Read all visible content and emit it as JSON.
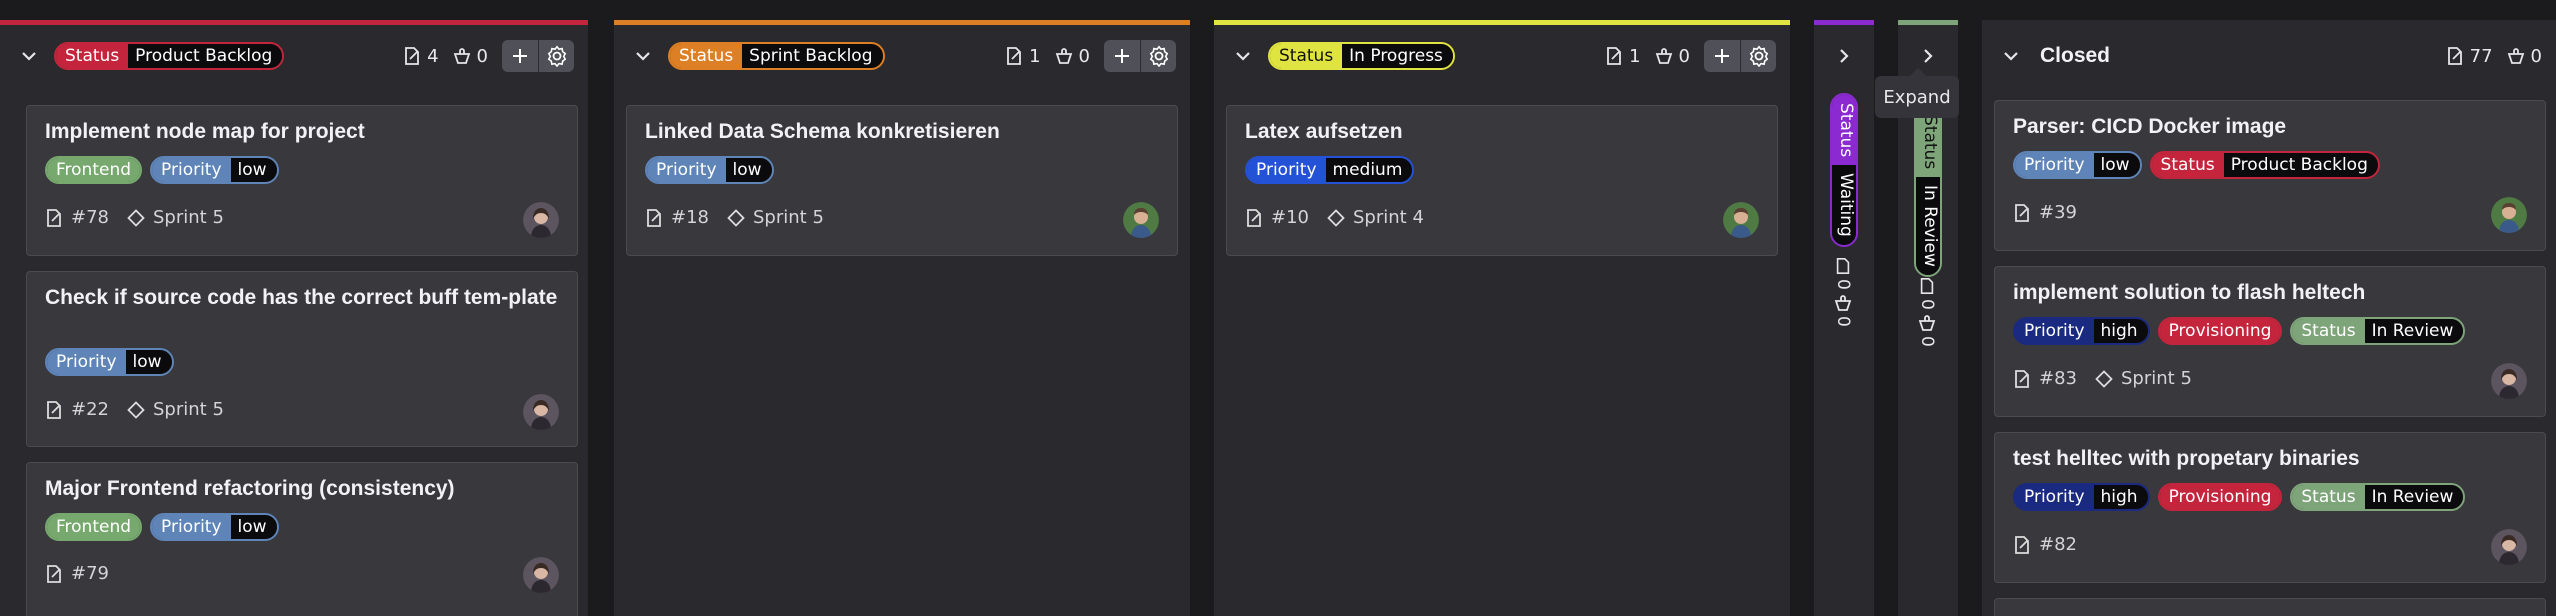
{
  "columns": [
    {
      "status_key": "Status",
      "status_value": "Product Backlog",
      "color": "#c4243c",
      "count_tasks": "4",
      "count_points": "0",
      "cards": [
        {
          "title": "Implement node map for project",
          "tags": [
            {
              "label": "Frontend",
              "type": "plain",
              "color": "#77a86e"
            },
            {
              "key": "Priority",
              "value": "low",
              "color": "#5e84b8"
            }
          ],
          "number": "#78",
          "sprint": "Sprint 5",
          "avatar": "woman"
        },
        {
          "title": "Check if source code has the correct buff tem-plate",
          "tags": [
            {
              "key": "Priority",
              "value": "low",
              "color": "#5e84b8"
            }
          ],
          "number": "#22",
          "sprint": "Sprint 5",
          "avatar": "woman"
        },
        {
          "title": "Major Frontend refactoring (consistency)",
          "tags": [
            {
              "label": "Frontend",
              "type": "plain",
              "color": "#77a86e"
            },
            {
              "key": "Priority",
              "value": "low",
              "color": "#5e84b8"
            }
          ],
          "number": "#79",
          "sprint": "",
          "avatar": "woman"
        }
      ]
    },
    {
      "status_key": "Status",
      "status_value": "Sprint Backlog",
      "color": "#dd7f24",
      "count_tasks": "1",
      "count_points": "0",
      "cards": [
        {
          "title": "Linked Data Schema konkretisieren",
          "tags": [
            {
              "key": "Priority",
              "value": "low",
              "color": "#5e84b8"
            }
          ],
          "number": "#18",
          "sprint": "Sprint 5",
          "avatar": "man"
        }
      ]
    },
    {
      "status_key": "Status",
      "status_value": "In Progress",
      "color": "#e0e440",
      "count_tasks": "1",
      "count_points": "0",
      "cards": [
        {
          "title": "Latex aufsetzen",
          "tags": [
            {
              "key": "Priority",
              "value": "medium",
              "color": "#2452d6"
            }
          ],
          "number": "#10",
          "sprint": "Sprint 4",
          "avatar": "man"
        }
      ]
    }
  ],
  "collapsed": [
    {
      "status_key": "Status",
      "status_value": "Waiting",
      "color": "#8a2ad0",
      "count_tasks": "0",
      "count_points": "0"
    },
    {
      "status_key": "Status",
      "status_value": "In Review",
      "color": "#7ea47a",
      "count_tasks": "0",
      "count_points": "0"
    }
  ],
  "tooltip": "Expand",
  "closed": {
    "title": "Closed",
    "count_tasks": "77",
    "count_points": "0",
    "cards": [
      {
        "title": "Parser: CICD Docker image",
        "tags": [
          {
            "key": "Priority",
            "value": "low",
            "color": "#5e84b8"
          },
          {
            "key": "Status",
            "value": "Product Backlog",
            "color": "#c4243c"
          }
        ],
        "number": "#39",
        "sprint": "",
        "avatar": "man"
      },
      {
        "title": "implement solution to flash heltech",
        "tags": [
          {
            "key": "Priority",
            "value": "high",
            "color": "#1a2a80"
          },
          {
            "label": "Provisioning",
            "type": "plain",
            "color": "#c4243c"
          },
          {
            "key": "Status",
            "value": "In Review",
            "color": "#7ea47a"
          }
        ],
        "number": "#83",
        "sprint": "Sprint 5",
        "avatar": "woman"
      },
      {
        "title": "test helltec with propetary binaries",
        "tags": [
          {
            "key": "Priority",
            "value": "high",
            "color": "#1a2a80"
          },
          {
            "label": "Provisioning",
            "type": "plain",
            "color": "#c4243c"
          },
          {
            "key": "Status",
            "value": "In Review",
            "color": "#7ea47a"
          }
        ],
        "number": "#82",
        "sprint": "",
        "avatar": "woman"
      }
    ]
  }
}
